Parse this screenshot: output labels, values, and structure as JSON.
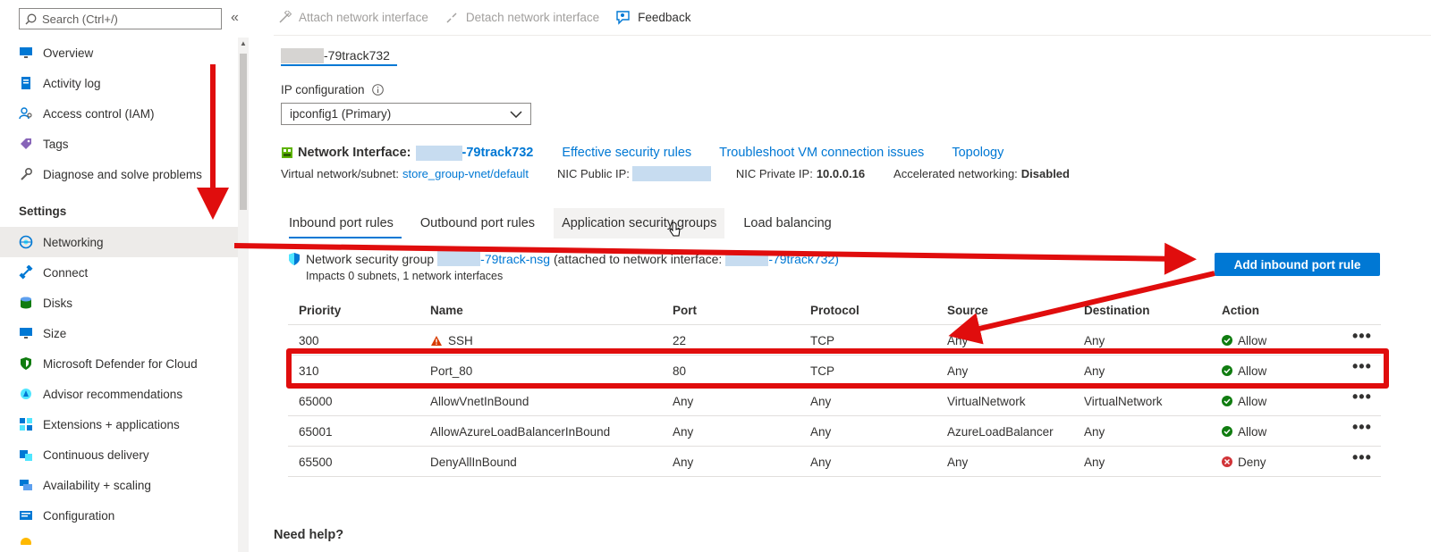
{
  "sidebar": {
    "search_placeholder": "Search (Ctrl+/)",
    "collapse_glyph": "«",
    "items": [
      {
        "label": "Overview",
        "icon": "overview-icon"
      },
      {
        "label": "Activity log",
        "icon": "activity-log-icon"
      },
      {
        "label": "Access control (IAM)",
        "icon": "iam-icon"
      },
      {
        "label": "Tags",
        "icon": "tag-icon"
      },
      {
        "label": "Diagnose and solve problems",
        "icon": "wrench-icon"
      }
    ],
    "section_settings": "Settings",
    "settings_items": [
      {
        "label": "Networking",
        "icon": "networking-icon",
        "selected": true
      },
      {
        "label": "Connect",
        "icon": "connect-icon"
      },
      {
        "label": "Disks",
        "icon": "disks-icon"
      },
      {
        "label": "Size",
        "icon": "size-icon"
      },
      {
        "label": "Microsoft Defender for Cloud",
        "icon": "defender-icon"
      },
      {
        "label": "Advisor recommendations",
        "icon": "advisor-icon"
      },
      {
        "label": "Extensions + applications",
        "icon": "extensions-icon"
      },
      {
        "label": "Continuous delivery",
        "icon": "continuous-delivery-icon"
      },
      {
        "label": "Availability + scaling",
        "icon": "availability-icon"
      },
      {
        "label": "Configuration",
        "icon": "configuration-icon"
      }
    ]
  },
  "toolbar": {
    "attach": "Attach network interface",
    "detach": "Detach network interface",
    "feedback": "Feedback"
  },
  "nic_tab": "-79track732",
  "ip_config": {
    "label": "IP configuration",
    "selected": "ipconfig1 (Primary)"
  },
  "nic": {
    "label": "Network Interface:",
    "name": "-79track732",
    "links": [
      "Effective security rules",
      "Troubleshoot VM connection issues",
      "Topology"
    ],
    "vnet_label": "Virtual network/subnet:",
    "vnet_value": "store_group-vnet/default",
    "public_ip_label": "NIC Public IP:",
    "private_ip_label": "NIC Private IP:",
    "private_ip_value": "10.0.0.16",
    "accel_label": "Accelerated networking:",
    "accel_value": "Disabled"
  },
  "tabs": [
    "Inbound port rules",
    "Outbound port rules",
    "Application security groups",
    "Load balancing"
  ],
  "nsg": {
    "prefix": "Network security group",
    "name": "-79track-nsg",
    "attached_text": "(attached to network interface:",
    "nic_name": "-79track732",
    "close_paren": ")",
    "impacts": "Impacts 0 subnets, 1 network interfaces",
    "add_button": "Add inbound port rule"
  },
  "table": {
    "headers": [
      "Priority",
      "Name",
      "Port",
      "Protocol",
      "Source",
      "Destination",
      "Action"
    ],
    "rows": [
      {
        "priority": "300",
        "name": "SSH",
        "warn": true,
        "port": "22",
        "protocol": "TCP",
        "source": "Any",
        "destination": "Any",
        "action": "Allow"
      },
      {
        "priority": "310",
        "name": "Port_80",
        "port": "80",
        "protocol": "TCP",
        "source": "Any",
        "destination": "Any",
        "action": "Allow"
      },
      {
        "priority": "65000",
        "name": "AllowVnetInBound",
        "port": "Any",
        "protocol": "Any",
        "source": "VirtualNetwork",
        "destination": "VirtualNetwork",
        "action": "Allow"
      },
      {
        "priority": "65001",
        "name": "AllowAzureLoadBalancerInBound",
        "port": "Any",
        "protocol": "Any",
        "source": "AzureLoadBalancer",
        "destination": "Any",
        "action": "Allow"
      },
      {
        "priority": "65500",
        "name": "DenyAllInBound",
        "port": "Any",
        "protocol": "Any",
        "source": "Any",
        "destination": "Any",
        "action": "Deny"
      }
    ],
    "more_glyph": "•••"
  },
  "need_help": "Need help?",
  "colors": {
    "accent": "#0078d4",
    "annotation_red": "#e00d0d",
    "allow_green": "#107c10",
    "deny_red": "#d13438",
    "warning": "#d83b01"
  }
}
